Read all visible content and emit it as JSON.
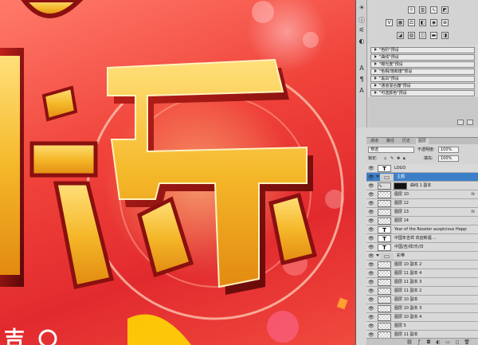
{
  "canvas": {
    "big_text": [
      "快",
      "乐"
    ],
    "bottom_text": "吉"
  },
  "iconstrip": {
    "icons": [
      "sun-icon",
      "info-icon",
      "sliders-icon",
      "adjust-icon",
      "text-icon",
      "paragraph-icon",
      "character-icon"
    ]
  },
  "presets": {
    "rows": [
      "\"色阶\"预设",
      "\"曲线\"预设",
      "\"曝光度\"预设",
      "\"色相/饱和度\"预设",
      "\"黑白\"预设",
      "\"通道混合器\"预设",
      "\"可选颜色\"预设"
    ]
  },
  "layers_panel": {
    "tabs": [
      "通道",
      "路径",
      "历史",
      "图层"
    ],
    "blend_mode": "穿透",
    "opacity_label": "不透明度:",
    "opacity_value": "100%",
    "lock_label": "锁定:",
    "fill_label": "填充:",
    "fill_value": "100%",
    "layers": [
      {
        "name": "LOGO",
        "kind": "text",
        "selected": false,
        "fx": false
      },
      {
        "name": "主题",
        "kind": "folder",
        "selected": true,
        "fx": false
      },
      {
        "name": "曲线 1 副本",
        "kind": "curve",
        "selected": false,
        "fx": false
      },
      {
        "name": "图层 10",
        "kind": "checker",
        "selected": false,
        "fx": true
      },
      {
        "name": "图层 12",
        "kind": "checker",
        "selected": false,
        "fx": false
      },
      {
        "name": "图层 13",
        "kind": "checker",
        "selected": false,
        "fx": true
      },
      {
        "name": "图层 14",
        "kind": "checker",
        "selected": false,
        "fx": false
      },
      {
        "name": "Year of the Rooster auspicious Happy ...",
        "kind": "text",
        "selected": false,
        "fx": false
      },
      {
        "name": "中国年吉祥 欢迎新福 ...",
        "kind": "text",
        "selected": false,
        "fx": false
      },
      {
        "name": "中国/吉/祥/乐/日",
        "kind": "text",
        "selected": false,
        "fx": false
      },
      {
        "name": "彩带",
        "kind": "folder",
        "selected": false,
        "fx": false
      },
      {
        "name": "图层 10 副本 2",
        "kind": "checker",
        "selected": false,
        "fx": false
      },
      {
        "name": "图层 11 副本 4",
        "kind": "checker",
        "selected": false,
        "fx": false
      },
      {
        "name": "图层 11 副本 3",
        "kind": "checker",
        "selected": false,
        "fx": false
      },
      {
        "name": "图层 11 副本 2",
        "kind": "checker",
        "selected": false,
        "fx": false
      },
      {
        "name": "图层 10 副本",
        "kind": "checker",
        "selected": false,
        "fx": false
      },
      {
        "name": "图层 10 副本 3",
        "kind": "checker",
        "selected": false,
        "fx": false
      },
      {
        "name": "图层 10 副本 4",
        "kind": "checker",
        "selected": false,
        "fx": false
      },
      {
        "name": "图层 5",
        "kind": "checker",
        "selected": false,
        "fx": false
      },
      {
        "name": "图层 11 副本",
        "kind": "checker",
        "selected": false,
        "fx": false
      }
    ],
    "fx_label": "fx"
  },
  "colors": {
    "selection": "#3d7fc7",
    "gold": "#f5c03a",
    "red_bg": "#e22a2e"
  }
}
